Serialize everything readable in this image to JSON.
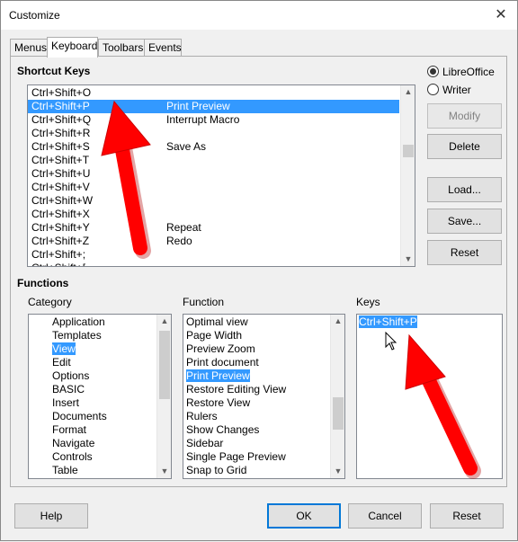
{
  "window": {
    "title": "Customize",
    "close_glyph": "✕"
  },
  "tabs": [
    {
      "label": "Menus"
    },
    {
      "label": "Keyboard",
      "active": true
    },
    {
      "label": "Toolbars"
    },
    {
      "label": "Events"
    }
  ],
  "shortcut_keys": {
    "title": "Shortcut Keys",
    "rows": [
      {
        "key": "Ctrl+Shift+O",
        "func": ""
      },
      {
        "key": "Ctrl+Shift+P",
        "func": "Print Preview",
        "selected": true
      },
      {
        "key": "Ctrl+Shift+Q",
        "func": "Interrupt Macro"
      },
      {
        "key": "Ctrl+Shift+R",
        "func": ""
      },
      {
        "key": "Ctrl+Shift+S",
        "func": "Save As"
      },
      {
        "key": "Ctrl+Shift+T",
        "func": ""
      },
      {
        "key": "Ctrl+Shift+U",
        "func": ""
      },
      {
        "key": "Ctrl+Shift+V",
        "func": ""
      },
      {
        "key": "Ctrl+Shift+W",
        "func": ""
      },
      {
        "key": "Ctrl+Shift+X",
        "func": ""
      },
      {
        "key": "Ctrl+Shift+Y",
        "func": "Repeat"
      },
      {
        "key": "Ctrl+Shift+Z",
        "func": "Redo"
      },
      {
        "key": "Ctrl+Shift+;",
        "func": ""
      },
      {
        "key": "Ctrl+Shift+[",
        "func": ""
      }
    ]
  },
  "scope": {
    "options": [
      {
        "label": "LibreOffice",
        "selected": true
      },
      {
        "label": "Writer",
        "selected": false
      }
    ]
  },
  "side_buttons": {
    "modify": "Modify",
    "delete": "Delete",
    "load": "Load...",
    "save": "Save...",
    "reset": "Reset"
  },
  "functions": {
    "title": "Functions",
    "category_label": "Category",
    "function_label": "Function",
    "keys_label": "Keys",
    "categories": [
      {
        "label": "Application"
      },
      {
        "label": "Templates"
      },
      {
        "label": "View",
        "selected": true
      },
      {
        "label": "Edit"
      },
      {
        "label": "Options"
      },
      {
        "label": "BASIC"
      },
      {
        "label": "Insert"
      },
      {
        "label": "Documents"
      },
      {
        "label": "Format"
      },
      {
        "label": "Navigate"
      },
      {
        "label": "Controls"
      },
      {
        "label": "Table"
      }
    ],
    "function_items": [
      {
        "label": "Optimal view"
      },
      {
        "label": "Page Width"
      },
      {
        "label": "Preview Zoom"
      },
      {
        "label": "Print document"
      },
      {
        "label": "Print Preview",
        "selected": true
      },
      {
        "label": "Restore Editing View"
      },
      {
        "label": "Restore View"
      },
      {
        "label": "Rulers"
      },
      {
        "label": "Show Changes"
      },
      {
        "label": "Sidebar"
      },
      {
        "label": "Single Page Preview"
      },
      {
        "label": "Snap to Grid"
      }
    ],
    "keys": [
      {
        "label": "Ctrl+Shift+P",
        "selected": true
      }
    ]
  },
  "footer": {
    "help": "Help",
    "ok": "OK",
    "cancel": "Cancel",
    "reset": "Reset"
  },
  "colors": {
    "selection": "#3399ff",
    "annotation_arrow": "#ff0000",
    "default_button_border": "#0078d7"
  }
}
